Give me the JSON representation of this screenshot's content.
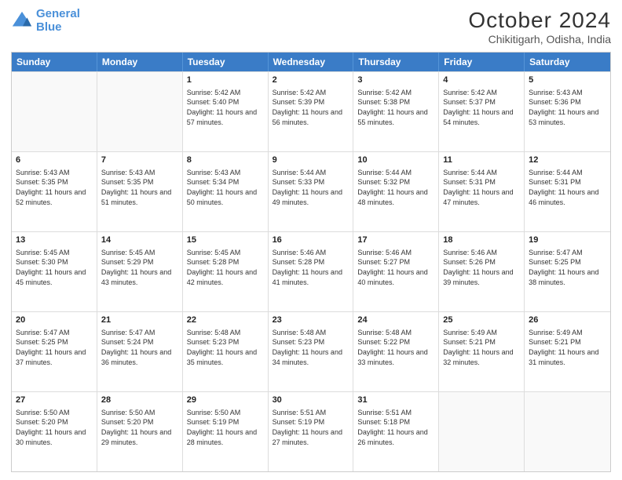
{
  "header": {
    "logo_line1": "General",
    "logo_line2": "Blue",
    "main_title": "October 2024",
    "subtitle": "Chikitigarh, Odisha, India"
  },
  "days_of_week": [
    "Sunday",
    "Monday",
    "Tuesday",
    "Wednesday",
    "Thursday",
    "Friday",
    "Saturday"
  ],
  "weeks": [
    [
      {
        "day": "",
        "text": ""
      },
      {
        "day": "",
        "text": ""
      },
      {
        "day": "1",
        "text": "Sunrise: 5:42 AM\nSunset: 5:40 PM\nDaylight: 11 hours and 57 minutes."
      },
      {
        "day": "2",
        "text": "Sunrise: 5:42 AM\nSunset: 5:39 PM\nDaylight: 11 hours and 56 minutes."
      },
      {
        "day": "3",
        "text": "Sunrise: 5:42 AM\nSunset: 5:38 PM\nDaylight: 11 hours and 55 minutes."
      },
      {
        "day": "4",
        "text": "Sunrise: 5:42 AM\nSunset: 5:37 PM\nDaylight: 11 hours and 54 minutes."
      },
      {
        "day": "5",
        "text": "Sunrise: 5:43 AM\nSunset: 5:36 PM\nDaylight: 11 hours and 53 minutes."
      }
    ],
    [
      {
        "day": "6",
        "text": "Sunrise: 5:43 AM\nSunset: 5:35 PM\nDaylight: 11 hours and 52 minutes."
      },
      {
        "day": "7",
        "text": "Sunrise: 5:43 AM\nSunset: 5:35 PM\nDaylight: 11 hours and 51 minutes."
      },
      {
        "day": "8",
        "text": "Sunrise: 5:43 AM\nSunset: 5:34 PM\nDaylight: 11 hours and 50 minutes."
      },
      {
        "day": "9",
        "text": "Sunrise: 5:44 AM\nSunset: 5:33 PM\nDaylight: 11 hours and 49 minutes."
      },
      {
        "day": "10",
        "text": "Sunrise: 5:44 AM\nSunset: 5:32 PM\nDaylight: 11 hours and 48 minutes."
      },
      {
        "day": "11",
        "text": "Sunrise: 5:44 AM\nSunset: 5:31 PM\nDaylight: 11 hours and 47 minutes."
      },
      {
        "day": "12",
        "text": "Sunrise: 5:44 AM\nSunset: 5:31 PM\nDaylight: 11 hours and 46 minutes."
      }
    ],
    [
      {
        "day": "13",
        "text": "Sunrise: 5:45 AM\nSunset: 5:30 PM\nDaylight: 11 hours and 45 minutes."
      },
      {
        "day": "14",
        "text": "Sunrise: 5:45 AM\nSunset: 5:29 PM\nDaylight: 11 hours and 43 minutes."
      },
      {
        "day": "15",
        "text": "Sunrise: 5:45 AM\nSunset: 5:28 PM\nDaylight: 11 hours and 42 minutes."
      },
      {
        "day": "16",
        "text": "Sunrise: 5:46 AM\nSunset: 5:28 PM\nDaylight: 11 hours and 41 minutes."
      },
      {
        "day": "17",
        "text": "Sunrise: 5:46 AM\nSunset: 5:27 PM\nDaylight: 11 hours and 40 minutes."
      },
      {
        "day": "18",
        "text": "Sunrise: 5:46 AM\nSunset: 5:26 PM\nDaylight: 11 hours and 39 minutes."
      },
      {
        "day": "19",
        "text": "Sunrise: 5:47 AM\nSunset: 5:25 PM\nDaylight: 11 hours and 38 minutes."
      }
    ],
    [
      {
        "day": "20",
        "text": "Sunrise: 5:47 AM\nSunset: 5:25 PM\nDaylight: 11 hours and 37 minutes."
      },
      {
        "day": "21",
        "text": "Sunrise: 5:47 AM\nSunset: 5:24 PM\nDaylight: 11 hours and 36 minutes."
      },
      {
        "day": "22",
        "text": "Sunrise: 5:48 AM\nSunset: 5:23 PM\nDaylight: 11 hours and 35 minutes."
      },
      {
        "day": "23",
        "text": "Sunrise: 5:48 AM\nSunset: 5:23 PM\nDaylight: 11 hours and 34 minutes."
      },
      {
        "day": "24",
        "text": "Sunrise: 5:48 AM\nSunset: 5:22 PM\nDaylight: 11 hours and 33 minutes."
      },
      {
        "day": "25",
        "text": "Sunrise: 5:49 AM\nSunset: 5:21 PM\nDaylight: 11 hours and 32 minutes."
      },
      {
        "day": "26",
        "text": "Sunrise: 5:49 AM\nSunset: 5:21 PM\nDaylight: 11 hours and 31 minutes."
      }
    ],
    [
      {
        "day": "27",
        "text": "Sunrise: 5:50 AM\nSunset: 5:20 PM\nDaylight: 11 hours and 30 minutes."
      },
      {
        "day": "28",
        "text": "Sunrise: 5:50 AM\nSunset: 5:20 PM\nDaylight: 11 hours and 29 minutes."
      },
      {
        "day": "29",
        "text": "Sunrise: 5:50 AM\nSunset: 5:19 PM\nDaylight: 11 hours and 28 minutes."
      },
      {
        "day": "30",
        "text": "Sunrise: 5:51 AM\nSunset: 5:19 PM\nDaylight: 11 hours and 27 minutes."
      },
      {
        "day": "31",
        "text": "Sunrise: 5:51 AM\nSunset: 5:18 PM\nDaylight: 11 hours and 26 minutes."
      },
      {
        "day": "",
        "text": ""
      },
      {
        "day": "",
        "text": ""
      }
    ]
  ]
}
